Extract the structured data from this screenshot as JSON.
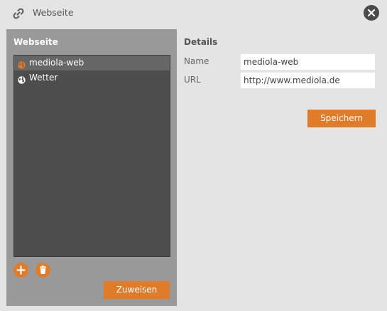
{
  "header": {
    "title": "Webseite",
    "icon": "link-icon",
    "close_icon": "close-icon"
  },
  "left_panel": {
    "title": "Webseite",
    "items": [
      {
        "label": "mediola-web",
        "icon": "globe-icon",
        "icon_color": "#e07b2a",
        "selected": true
      },
      {
        "label": "Wetter",
        "icon": "globe-icon",
        "icon_color": "#ffffff",
        "selected": false
      }
    ],
    "add_icon": "plus-icon",
    "delete_icon": "trash-icon",
    "assign_label": "Zuweisen"
  },
  "details": {
    "title": "Details",
    "name_label": "Name",
    "name_value": "mediola-web",
    "url_label": "URL",
    "url_value": "http://www.mediola.de",
    "save_label": "Speichern"
  },
  "colors": {
    "accent": "#e07b2a",
    "panel": "#999999",
    "list_bg": "#4d4d4d",
    "selected_bg": "#666666",
    "background": "#e4e4e4"
  }
}
